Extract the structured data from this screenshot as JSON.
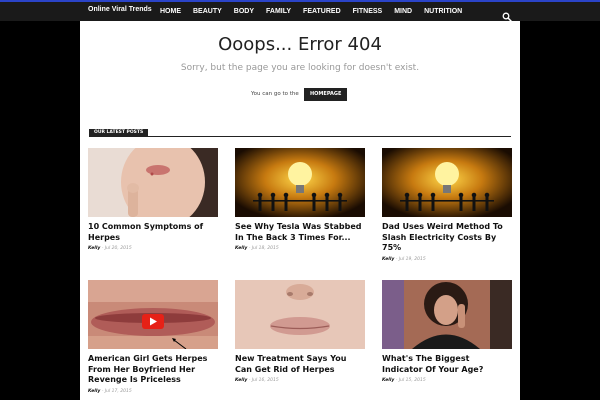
{
  "header": {
    "logo": "Online Viral Trends",
    "menu": [
      "HOME",
      "BEAUTY",
      "BODY",
      "FAMILY",
      "FEATURED",
      "FITNESS",
      "MIND",
      "NUTRITION"
    ]
  },
  "error": {
    "title": "Ooops... Error 404",
    "subtitle": "Sorry, but the page you are looking for doesn't exist.",
    "goto_text": "You can go to the",
    "homepage_button": "HOMEPAGE"
  },
  "latest": {
    "heading": "OUR LATEST POSTS",
    "posts": [
      {
        "title": "10 Common Symptoms of Herpes",
        "author": "Kelly",
        "date": "Jul 20, 2015"
      },
      {
        "title": "See Why Tesla Was Stabbed In The Back 3 Times For...",
        "author": "Kelly",
        "date": "Jul 18, 2015"
      },
      {
        "title": "Dad Uses Weird Method To Slash Electricity Costs By 75%",
        "author": "Kelly",
        "date": "Jul 19, 2015"
      },
      {
        "title": "American Girl Gets Herpes From Her Boyfriend Her Revenge Is Priceless",
        "author": "Kelly",
        "date": "Jul 17, 2015"
      },
      {
        "title": "New Treatment Says You Can Get Rid of Herpes",
        "author": "Kelly",
        "date": "Jul 16, 2015"
      },
      {
        "title": "What's The Biggest Indicator Of Your Age?",
        "author": "Kelly",
        "date": "Jul 15, 2015"
      }
    ]
  },
  "colors": {
    "topline": "#2b44c8",
    "nav_bg": "#1a1a1a",
    "page_bg": "#000000"
  }
}
